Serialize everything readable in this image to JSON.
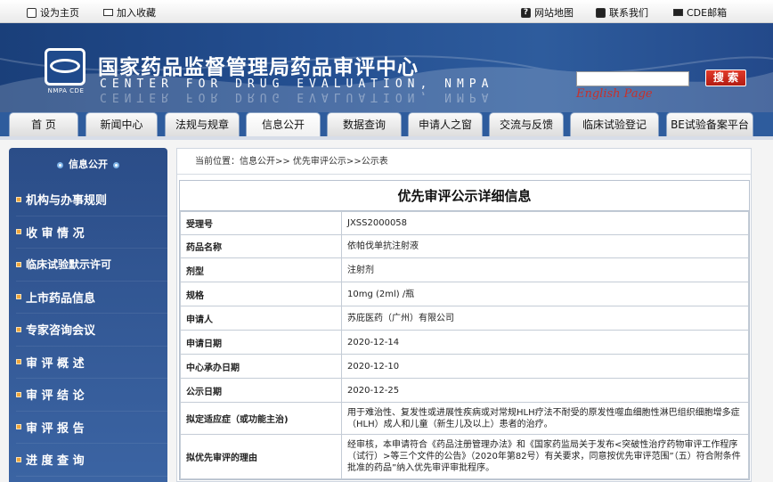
{
  "topbar": {
    "set_home": "设为主页",
    "add_fav": "加入收藏",
    "site_map": "网站地图",
    "contact": "联系我们",
    "cde_mail": "CDE邮箱"
  },
  "header": {
    "cn_title": "国家药品监督管理局药品审评中心",
    "en_title": "CENTER FOR DRUG EVALUATION, NMPA",
    "logo_caption": "NMPA CDE",
    "search_button": "搜 索",
    "search_value": "",
    "english_link": "English Page"
  },
  "nav": {
    "tabs": [
      {
        "label": "首 页"
      },
      {
        "label": "新闻中心"
      },
      {
        "label": "法规与规章"
      },
      {
        "label": "信息公开"
      },
      {
        "label": "数据查询"
      },
      {
        "label": "申请人之窗"
      },
      {
        "label": "交流与反馈"
      },
      {
        "label": "临床试验登记"
      },
      {
        "label": "BE试验备案平台"
      }
    ],
    "active": "信息公开"
  },
  "sidebar": {
    "title": "信息公开",
    "items": [
      {
        "label": "机构与办事规则"
      },
      {
        "label": "收 审 情 况"
      },
      {
        "label": "临床试验默示许可"
      },
      {
        "label": "上市药品信息"
      },
      {
        "label": "专家咨询会议"
      },
      {
        "label": "审 评 概 述"
      },
      {
        "label": "审 评 结 论"
      },
      {
        "label": "审 评 报 告"
      },
      {
        "label": "进 度 查 询"
      }
    ]
  },
  "breadcrumb": "当前位置：信息公开>> 优先审评公示>>公示表",
  "detail": {
    "title": "优先审评公示详细信息",
    "rows": [
      {
        "key": "受理号",
        "value": "JXSS2000058"
      },
      {
        "key": "药品名称",
        "value": "依帕伐单抗注射液"
      },
      {
        "key": "剂型",
        "value": "注射剂"
      },
      {
        "key": "规格",
        "value": "10mg (2ml) /瓶"
      },
      {
        "key": "申请人",
        "value": "苏庇医药（广州）有限公司"
      },
      {
        "key": "申请日期",
        "value": "2020-12-14"
      },
      {
        "key": "中心承办日期",
        "value": "2020-12-10"
      },
      {
        "key": "公示日期",
        "value": "2020-12-25"
      },
      {
        "key": "拟定适应症（或功能主治)",
        "value": "用于难治性、复发性或进展性疾病或对常规HLH疗法不耐受的原发性噬血细胞性淋巴组织细胞增多症（HLH）成人和儿童（新生儿及以上）患者的治疗。"
      },
      {
        "key": "拟优先审评的理由",
        "value": "经审核，本申请符合《药品注册管理办法》和《国家药监局关于发布<突破性治疗药物审评工作程序（试行）>等三个文件的公告》（2020年第82号）有关要求，同意按优先审评范围”（五）符合附条件批准的药品”纳入优先审评审批程序。"
      }
    ]
  }
}
